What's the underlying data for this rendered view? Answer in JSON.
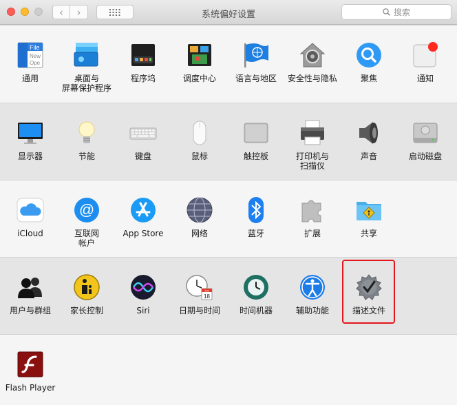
{
  "window": {
    "title": "系统偏好设置"
  },
  "toolbar": {
    "back": "‹",
    "forward": "›",
    "search_placeholder": "搜索"
  },
  "rows": [
    {
      "panes": [
        {
          "id": "general",
          "label": [
            "通用"
          ],
          "icon_text": "File",
          "icon_lines": [
            "New",
            "Ope"
          ]
        },
        {
          "id": "desktop",
          "label": [
            "桌面与",
            "屏幕保护程序"
          ]
        },
        {
          "id": "dock",
          "label": [
            "程序坞"
          ]
        },
        {
          "id": "mission",
          "label": [
            "调度中心"
          ]
        },
        {
          "id": "language",
          "label": [
            "语言与地区"
          ]
        },
        {
          "id": "security",
          "label": [
            "安全性与隐私"
          ]
        },
        {
          "id": "spotlight",
          "label": [
            "聚焦"
          ]
        },
        {
          "id": "notifications",
          "label": [
            "通知"
          ]
        }
      ]
    },
    {
      "panes": [
        {
          "id": "displays",
          "label": [
            "显示器"
          ]
        },
        {
          "id": "energy",
          "label": [
            "节能"
          ]
        },
        {
          "id": "keyboard",
          "label": [
            "键盘"
          ]
        },
        {
          "id": "mouse",
          "label": [
            "鼠标"
          ]
        },
        {
          "id": "trackpad",
          "label": [
            "触控板"
          ]
        },
        {
          "id": "printers",
          "label": [
            "打印机与",
            "扫描仪"
          ]
        },
        {
          "id": "sound",
          "label": [
            "声音"
          ]
        },
        {
          "id": "startup",
          "label": [
            "启动磁盘"
          ]
        }
      ]
    },
    {
      "panes": [
        {
          "id": "icloud",
          "label": [
            "iCloud"
          ]
        },
        {
          "id": "internet",
          "label": [
            "互联网",
            "帐户"
          ]
        },
        {
          "id": "appstore",
          "label": [
            "App Store"
          ]
        },
        {
          "id": "network",
          "label": [
            "网络"
          ]
        },
        {
          "id": "bluetooth",
          "label": [
            "蓝牙"
          ]
        },
        {
          "id": "extensions",
          "label": [
            "扩展"
          ]
        },
        {
          "id": "sharing",
          "label": [
            "共享"
          ]
        }
      ]
    },
    {
      "panes": [
        {
          "id": "users",
          "label": [
            "用户与群组"
          ]
        },
        {
          "id": "parental",
          "label": [
            "家长控制"
          ]
        },
        {
          "id": "siri",
          "label": [
            "Siri"
          ]
        },
        {
          "id": "datetime",
          "label": [
            "日期与时间"
          ],
          "icon_text": "18",
          "icon_small": "JUL"
        },
        {
          "id": "timemachine",
          "label": [
            "时间机器"
          ]
        },
        {
          "id": "accessibility",
          "label": [
            "辅助功能"
          ]
        },
        {
          "id": "profiles",
          "label": [
            "描述文件"
          ],
          "highlighted": true
        }
      ]
    },
    {
      "panes": [
        {
          "id": "flash",
          "label": [
            "Flash Player"
          ]
        }
      ]
    }
  ],
  "colors": {
    "highlight": "#e3161b",
    "accent_blue": "#1a8cf0",
    "spotlight_blue": "#2f9af5"
  }
}
